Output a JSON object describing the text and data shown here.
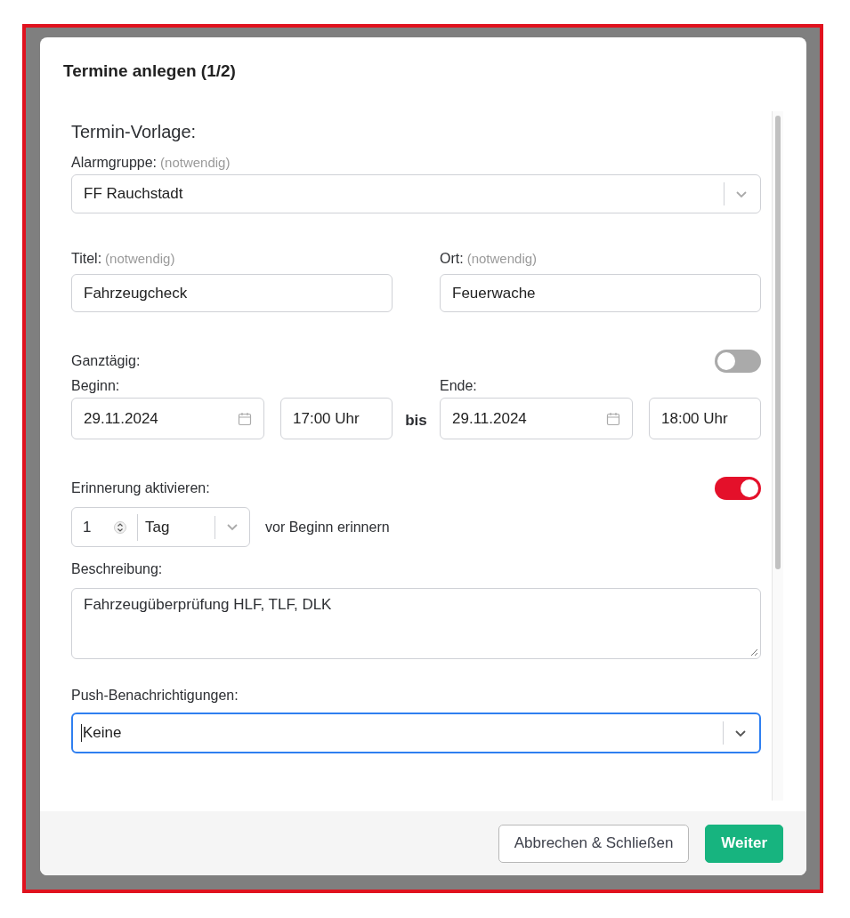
{
  "dialog": {
    "title": "Termine anlegen (1/2)"
  },
  "section_title": "Termin-Vorlage:",
  "alarm_group": {
    "label": "Alarmgruppe:",
    "hint": "(notwendig)",
    "value": "FF Rauchstadt"
  },
  "title_field": {
    "label": "Titel:",
    "hint": "(notwendig)",
    "value": "Fahrzeugcheck"
  },
  "location_field": {
    "label": "Ort:",
    "hint": "(notwendig)",
    "value": "Feuerwache"
  },
  "all_day": {
    "label": "Ganztägig:",
    "on": false
  },
  "start": {
    "label": "Beginn:",
    "date": "29.11.2024",
    "time": "17:00 Uhr"
  },
  "separator": "bis",
  "end": {
    "label": "Ende:",
    "date": "29.11.2024",
    "time": "18:00 Uhr"
  },
  "reminder": {
    "label": "Erinnerung aktivieren:",
    "on": true,
    "amount": "1",
    "unit": "Tag",
    "suffix": "vor Beginn erinnern"
  },
  "description": {
    "label": "Beschreibung:",
    "value": "Fahrzeugüberprüfung HLF, TLF, DLK"
  },
  "push": {
    "label": "Push-Benachrichtigungen:",
    "value": "Keine",
    "focused": true
  },
  "buttons": [
    {
      "label": "Abbrechen & Schließen",
      "kind": "secondary"
    },
    {
      "label": "Weiter",
      "kind": "primary"
    }
  ]
}
